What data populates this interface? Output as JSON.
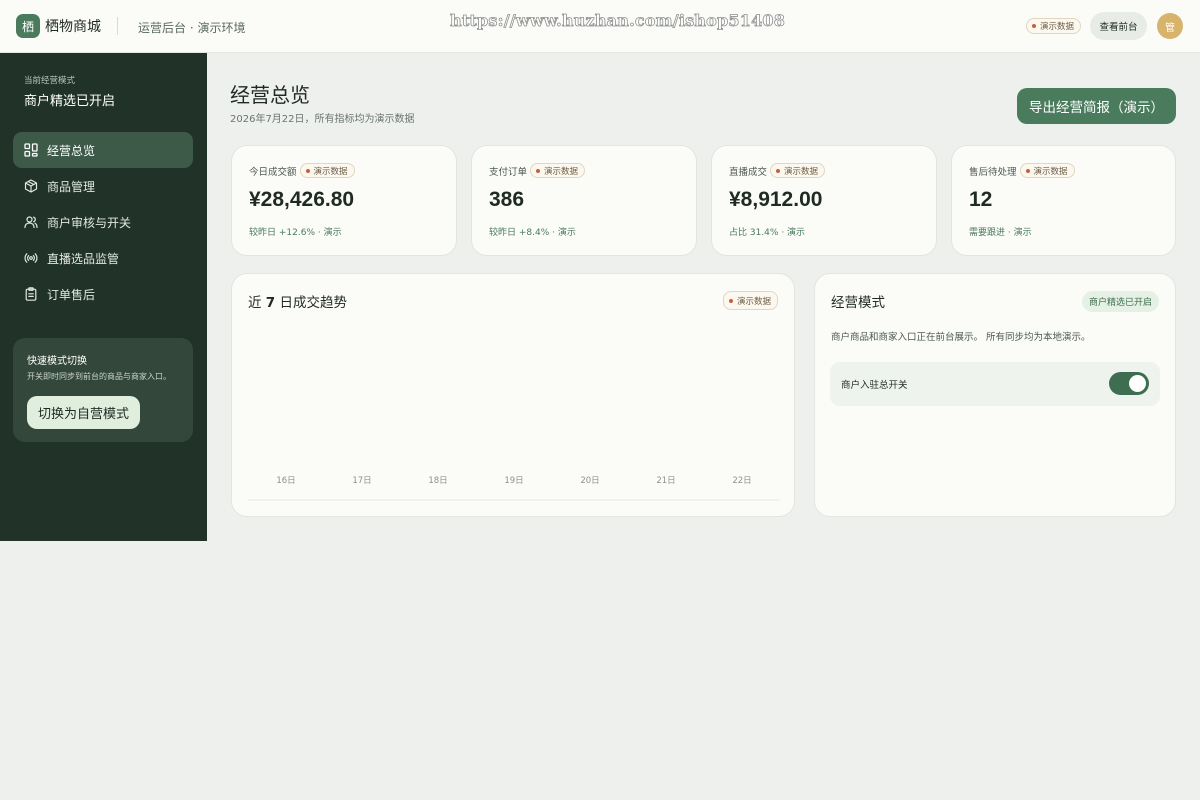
{
  "header": {
    "logo_char": "栖",
    "brand": "栖物商城",
    "subtitle": "运营后台 · 演示环境",
    "watermark": "https://www.huzhan.com/ishop51408",
    "demo_badge": "演示数据",
    "front_button": "查看前台",
    "avatar_char": "管"
  },
  "sidebar": {
    "mode_label": "当前经营模式",
    "mode_value": "商户精选已开启",
    "items": [
      {
        "label": "经营总览",
        "icon": "grid-icon",
        "active": true
      },
      {
        "label": "商品管理",
        "icon": "box-icon",
        "active": false
      },
      {
        "label": "商户审核与开关",
        "icon": "users-icon",
        "active": false
      },
      {
        "label": "直播选品监管",
        "icon": "broadcast-icon",
        "active": false
      },
      {
        "label": "订单售后",
        "icon": "clipboard-icon",
        "active": false
      }
    ],
    "quick_switch": {
      "title": "快速模式切换",
      "desc": "开关即时同步到前台的商品与商家入口。",
      "button": "切换为自营模式"
    }
  },
  "main": {
    "title": "经营总览",
    "subtitle": "2026年7月22日，所有指标均为演示数据",
    "export_button": "导出经营简报（演示）",
    "stats": [
      {
        "label": "今日成交额",
        "badge": "演示数据",
        "value": "¥28,426.80",
        "foot": "较昨日 +12.6% · 演示"
      },
      {
        "label": "支付订单",
        "badge": "演示数据",
        "value": "386",
        "foot": "较昨日 +8.4% · 演示"
      },
      {
        "label": "直播成交",
        "badge": "演示数据",
        "value": "¥8,912.00",
        "foot": "占比 31.4% · 演示"
      },
      {
        "label": "售后待处理",
        "badge": "演示数据",
        "value": "12",
        "foot": "需要跟进 · 演示"
      }
    ],
    "chart_card": {
      "title_prefix": "近 ",
      "title_num": "7",
      "title_suffix": " 日成交趋势",
      "badge": "演示数据"
    },
    "mode_card": {
      "title": "经营模式",
      "badge": "商户精选已开启",
      "desc": "商户商品和商家入口正在前台展示。 所有同步均为本地演示。",
      "switch_label": "商户入驻总开关",
      "switch_on": true
    }
  },
  "chart_data": {
    "type": "bar",
    "title": "近 7 日成交趋势",
    "categories": [
      "16日",
      "17日",
      "18日",
      "19日",
      "20日",
      "21日",
      "22日"
    ],
    "values": [],
    "xlabel": "",
    "ylabel": ""
  },
  "colors": {
    "accent": "#4a7b5c",
    "sidebar_bg": "#213328",
    "demo_dot": "#c2623f"
  }
}
